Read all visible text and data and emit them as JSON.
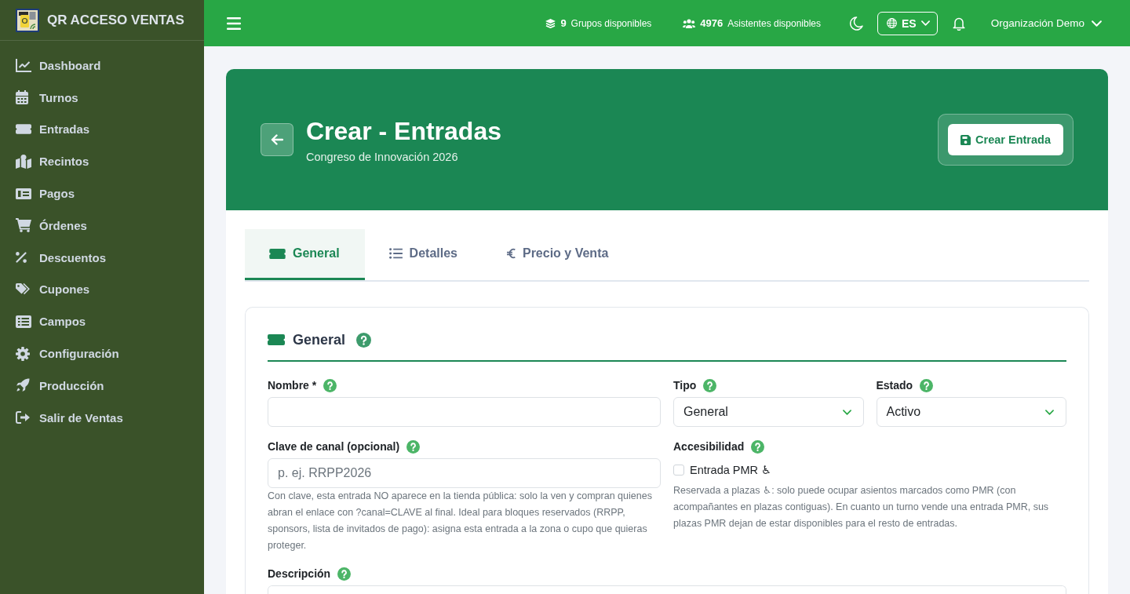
{
  "sidebar": {
    "brand": "QR ACCESO VENTAS",
    "items": [
      {
        "label": "Dashboard",
        "selected": false
      },
      {
        "label": "Turnos",
        "selected": false
      },
      {
        "label": "Entradas",
        "selected": false
      },
      {
        "label": "Recintos",
        "selected": false
      },
      {
        "label": "Pagos",
        "selected": false
      },
      {
        "label": "Órdenes",
        "selected": false
      },
      {
        "label": "Descuentos",
        "selected": false
      },
      {
        "label": "Cupones",
        "selected": false
      },
      {
        "label": "Campos",
        "selected": false
      },
      {
        "label": "Configuración",
        "selected": false
      },
      {
        "label": "Producción",
        "selected": false
      },
      {
        "label": "Salir de Ventas",
        "selected": false
      }
    ]
  },
  "topbar": {
    "stats": [
      {
        "count": "9",
        "label": "Grupos disponibles"
      },
      {
        "count": "4976",
        "label": "Asistentes disponibles"
      }
    ],
    "language": "ES",
    "user": "Organización Demo"
  },
  "header": {
    "title": "Crear - Entradas",
    "subtitle": "Congreso de Innovación 2026",
    "action": "Crear Entrada"
  },
  "tabs": [
    {
      "label": "General",
      "selected": true
    },
    {
      "label": "Detalles",
      "selected": false
    },
    {
      "label": "Precio y Venta",
      "selected": false
    }
  ],
  "form": {
    "title": "General",
    "rows": [
      [
        {
          "kind": "text",
          "label": "Nombre *"
        },
        {
          "kind": "select",
          "label": "Tipo",
          "value": "General"
        },
        {
          "kind": "select",
          "label": "Estado",
          "value": "Activo"
        }
      ],
      [
        {
          "kind": "text",
          "label": "Clave de canal (opcional)",
          "placeholder": "p. ej. RRPP2026",
          "note": "Con clave, esta entrada NO aparece en la tienda pública: solo la ven y compran quienes abran el enlace con ?canal=CLAVE al final. Ideal para bloques reservados (RRPP, sponsors, lista de invitados de pago): asigna esta entrada a la zona o cupo que quieras proteger."
        },
        {
          "kind": "checkbox",
          "label": "Accesibilidad",
          "option": "Entrada PMR ♿",
          "checked": false,
          "note": "Reservada a plazas ♿: solo puede ocupar asientos marcados como PMR (con acompañantes en plazas contiguas). En cuanto un turno vende una entrada PMR, sus plazas PMR dejan de estar disponibles para el resto de entradas."
        }
      ],
      [
        {
          "kind": "textarea",
          "label": "Descripción"
        }
      ]
    ]
  }
}
